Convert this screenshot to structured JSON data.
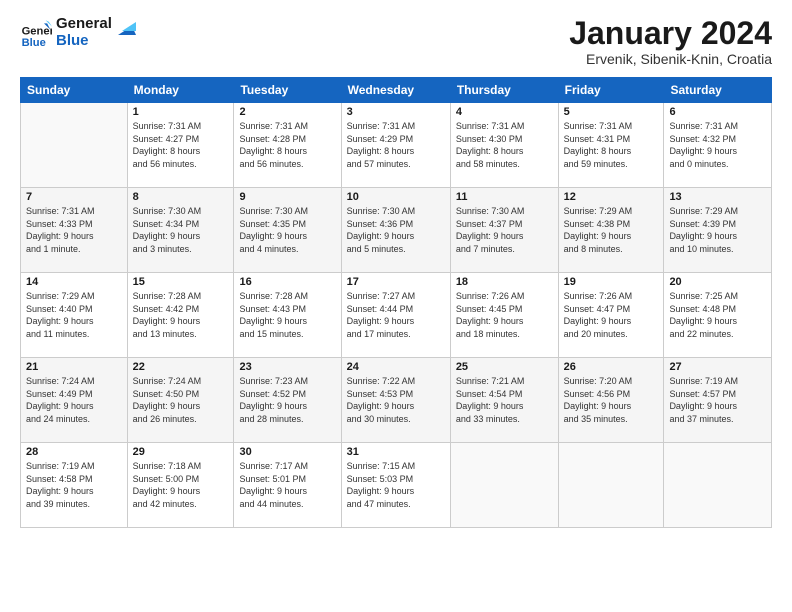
{
  "logo": {
    "line1": "General",
    "line2": "Blue"
  },
  "title": "January 2024",
  "location": "Ervenik, Sibenik-Knin, Croatia",
  "days_header": [
    "Sunday",
    "Monday",
    "Tuesday",
    "Wednesday",
    "Thursday",
    "Friday",
    "Saturday"
  ],
  "weeks": [
    [
      {
        "day": "",
        "info": ""
      },
      {
        "day": "1",
        "info": "Sunrise: 7:31 AM\nSunset: 4:27 PM\nDaylight: 8 hours\nand 56 minutes."
      },
      {
        "day": "2",
        "info": "Sunrise: 7:31 AM\nSunset: 4:28 PM\nDaylight: 8 hours\nand 56 minutes."
      },
      {
        "day": "3",
        "info": "Sunrise: 7:31 AM\nSunset: 4:29 PM\nDaylight: 8 hours\nand 57 minutes."
      },
      {
        "day": "4",
        "info": "Sunrise: 7:31 AM\nSunset: 4:30 PM\nDaylight: 8 hours\nand 58 minutes."
      },
      {
        "day": "5",
        "info": "Sunrise: 7:31 AM\nSunset: 4:31 PM\nDaylight: 8 hours\nand 59 minutes."
      },
      {
        "day": "6",
        "info": "Sunrise: 7:31 AM\nSunset: 4:32 PM\nDaylight: 9 hours\nand 0 minutes."
      }
    ],
    [
      {
        "day": "7",
        "info": "Sunrise: 7:31 AM\nSunset: 4:33 PM\nDaylight: 9 hours\nand 1 minute."
      },
      {
        "day": "8",
        "info": "Sunrise: 7:30 AM\nSunset: 4:34 PM\nDaylight: 9 hours\nand 3 minutes."
      },
      {
        "day": "9",
        "info": "Sunrise: 7:30 AM\nSunset: 4:35 PM\nDaylight: 9 hours\nand 4 minutes."
      },
      {
        "day": "10",
        "info": "Sunrise: 7:30 AM\nSunset: 4:36 PM\nDaylight: 9 hours\nand 5 minutes."
      },
      {
        "day": "11",
        "info": "Sunrise: 7:30 AM\nSunset: 4:37 PM\nDaylight: 9 hours\nand 7 minutes."
      },
      {
        "day": "12",
        "info": "Sunrise: 7:29 AM\nSunset: 4:38 PM\nDaylight: 9 hours\nand 8 minutes."
      },
      {
        "day": "13",
        "info": "Sunrise: 7:29 AM\nSunset: 4:39 PM\nDaylight: 9 hours\nand 10 minutes."
      }
    ],
    [
      {
        "day": "14",
        "info": "Sunrise: 7:29 AM\nSunset: 4:40 PM\nDaylight: 9 hours\nand 11 minutes."
      },
      {
        "day": "15",
        "info": "Sunrise: 7:28 AM\nSunset: 4:42 PM\nDaylight: 9 hours\nand 13 minutes."
      },
      {
        "day": "16",
        "info": "Sunrise: 7:28 AM\nSunset: 4:43 PM\nDaylight: 9 hours\nand 15 minutes."
      },
      {
        "day": "17",
        "info": "Sunrise: 7:27 AM\nSunset: 4:44 PM\nDaylight: 9 hours\nand 17 minutes."
      },
      {
        "day": "18",
        "info": "Sunrise: 7:26 AM\nSunset: 4:45 PM\nDaylight: 9 hours\nand 18 minutes."
      },
      {
        "day": "19",
        "info": "Sunrise: 7:26 AM\nSunset: 4:47 PM\nDaylight: 9 hours\nand 20 minutes."
      },
      {
        "day": "20",
        "info": "Sunrise: 7:25 AM\nSunset: 4:48 PM\nDaylight: 9 hours\nand 22 minutes."
      }
    ],
    [
      {
        "day": "21",
        "info": "Sunrise: 7:24 AM\nSunset: 4:49 PM\nDaylight: 9 hours\nand 24 minutes."
      },
      {
        "day": "22",
        "info": "Sunrise: 7:24 AM\nSunset: 4:50 PM\nDaylight: 9 hours\nand 26 minutes."
      },
      {
        "day": "23",
        "info": "Sunrise: 7:23 AM\nSunset: 4:52 PM\nDaylight: 9 hours\nand 28 minutes."
      },
      {
        "day": "24",
        "info": "Sunrise: 7:22 AM\nSunset: 4:53 PM\nDaylight: 9 hours\nand 30 minutes."
      },
      {
        "day": "25",
        "info": "Sunrise: 7:21 AM\nSunset: 4:54 PM\nDaylight: 9 hours\nand 33 minutes."
      },
      {
        "day": "26",
        "info": "Sunrise: 7:20 AM\nSunset: 4:56 PM\nDaylight: 9 hours\nand 35 minutes."
      },
      {
        "day": "27",
        "info": "Sunrise: 7:19 AM\nSunset: 4:57 PM\nDaylight: 9 hours\nand 37 minutes."
      }
    ],
    [
      {
        "day": "28",
        "info": "Sunrise: 7:19 AM\nSunset: 4:58 PM\nDaylight: 9 hours\nand 39 minutes."
      },
      {
        "day": "29",
        "info": "Sunrise: 7:18 AM\nSunset: 5:00 PM\nDaylight: 9 hours\nand 42 minutes."
      },
      {
        "day": "30",
        "info": "Sunrise: 7:17 AM\nSunset: 5:01 PM\nDaylight: 9 hours\nand 44 minutes."
      },
      {
        "day": "31",
        "info": "Sunrise: 7:15 AM\nSunset: 5:03 PM\nDaylight: 9 hours\nand 47 minutes."
      },
      {
        "day": "",
        "info": ""
      },
      {
        "day": "",
        "info": ""
      },
      {
        "day": "",
        "info": ""
      }
    ]
  ]
}
